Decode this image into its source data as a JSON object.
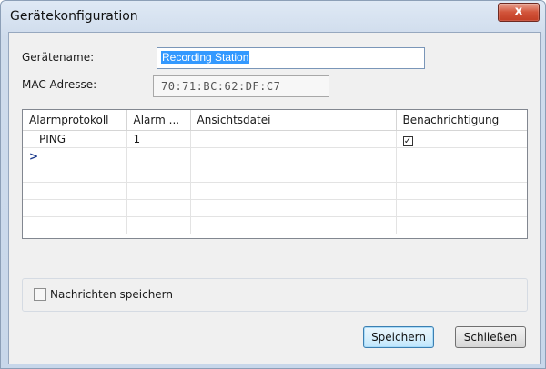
{
  "window": {
    "title": "Gerätekonfiguration",
    "close_glyph": "x"
  },
  "form": {
    "device_name_label": "Gerätename:",
    "device_name_value": "Recording Station",
    "mac_label": "MAC Adresse:",
    "mac_value": "70:71:BC:62:DF:C7"
  },
  "grid": {
    "columns": [
      "Alarmprotokoll",
      "Alarm ...",
      "Ansichtsdatei",
      "Benachrichtigung"
    ],
    "rows": [
      {
        "protocol": "PING",
        "alarm": "1",
        "view_file": "",
        "notify_checked": true,
        "notify_glyph": "✓"
      }
    ],
    "new_row_glyph": ">"
  },
  "options": {
    "save_messages_label": "Nachrichten speichern",
    "save_messages_checked": false
  },
  "buttons": {
    "save_label": "Speichern",
    "close_label": "Schließen"
  },
  "colors": {
    "selection": "#3399ff",
    "close_button": "#c13d24",
    "default_button_border": "#3c7fb1"
  },
  "icons": {
    "close": "close-icon",
    "checkbox_checked": "checkmark-icon",
    "new_row": "row-indicator-icon"
  }
}
